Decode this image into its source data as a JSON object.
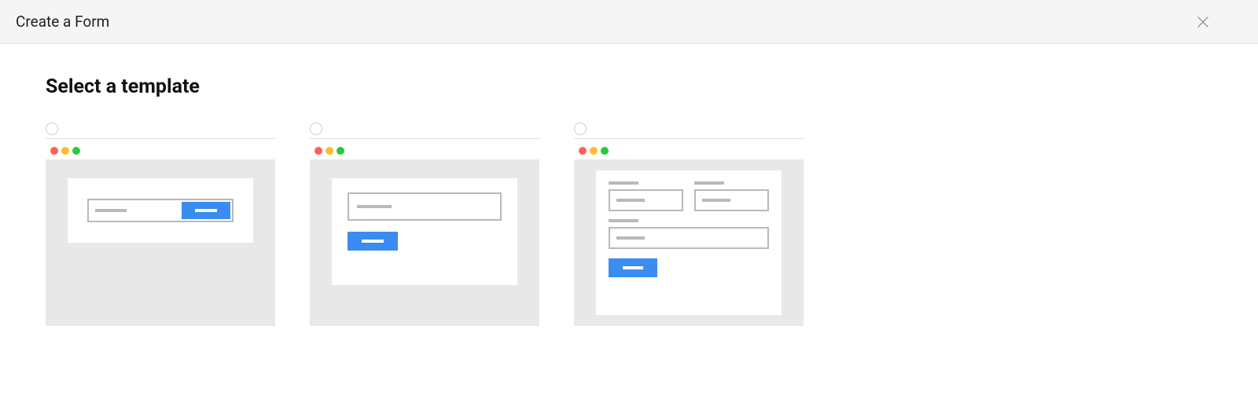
{
  "header": {
    "title": "Create a Form"
  },
  "main": {
    "heading": "Select a template",
    "templates": [
      {
        "id": "template-inline",
        "selected": false
      },
      {
        "id": "template-stacked",
        "selected": false
      },
      {
        "id": "template-multi-field",
        "selected": false
      }
    ]
  },
  "colors": {
    "accent": "#3b8cf0",
    "traffic_red": "#ff5f57",
    "traffic_yellow": "#febc2e",
    "traffic_green": "#28c840"
  }
}
